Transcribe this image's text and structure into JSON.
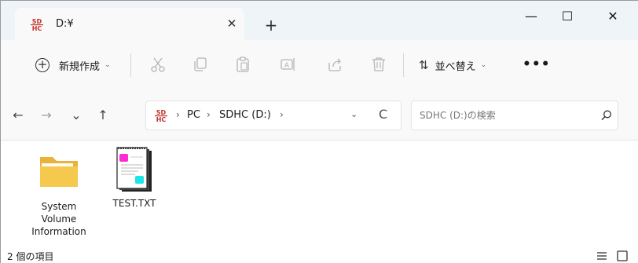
{
  "window": {
    "tab_title": "D:¥",
    "tab_close_glyph": "✕",
    "new_tab_glyph": "+",
    "controls": {
      "minimize": "—",
      "maximize": "☐",
      "close": "✕"
    }
  },
  "toolbar": {
    "new_label": "新規作成",
    "sort_label": "並べ替え",
    "more_glyph": "•••"
  },
  "navigation": {
    "back": "←",
    "forward": "→",
    "recent": "⌄",
    "up": "↑"
  },
  "address": {
    "crumbs": [
      "PC",
      "SDHC (D:)"
    ],
    "separator": "›",
    "refresh_glyph": "C"
  },
  "search": {
    "placeholder": "SDHC (D:)の検索"
  },
  "files": [
    {
      "name": "System Volume Information",
      "type": "folder"
    },
    {
      "name": "TEST.TXT",
      "type": "text-file"
    }
  ],
  "status": {
    "item_count": "2 個の項目"
  },
  "colors": {
    "titlebar_bg": "#eff4f9",
    "toolbar_bg": "#f9f9f9",
    "folder_yellow": "#f5c94e",
    "sd_red": "#c0302a"
  }
}
